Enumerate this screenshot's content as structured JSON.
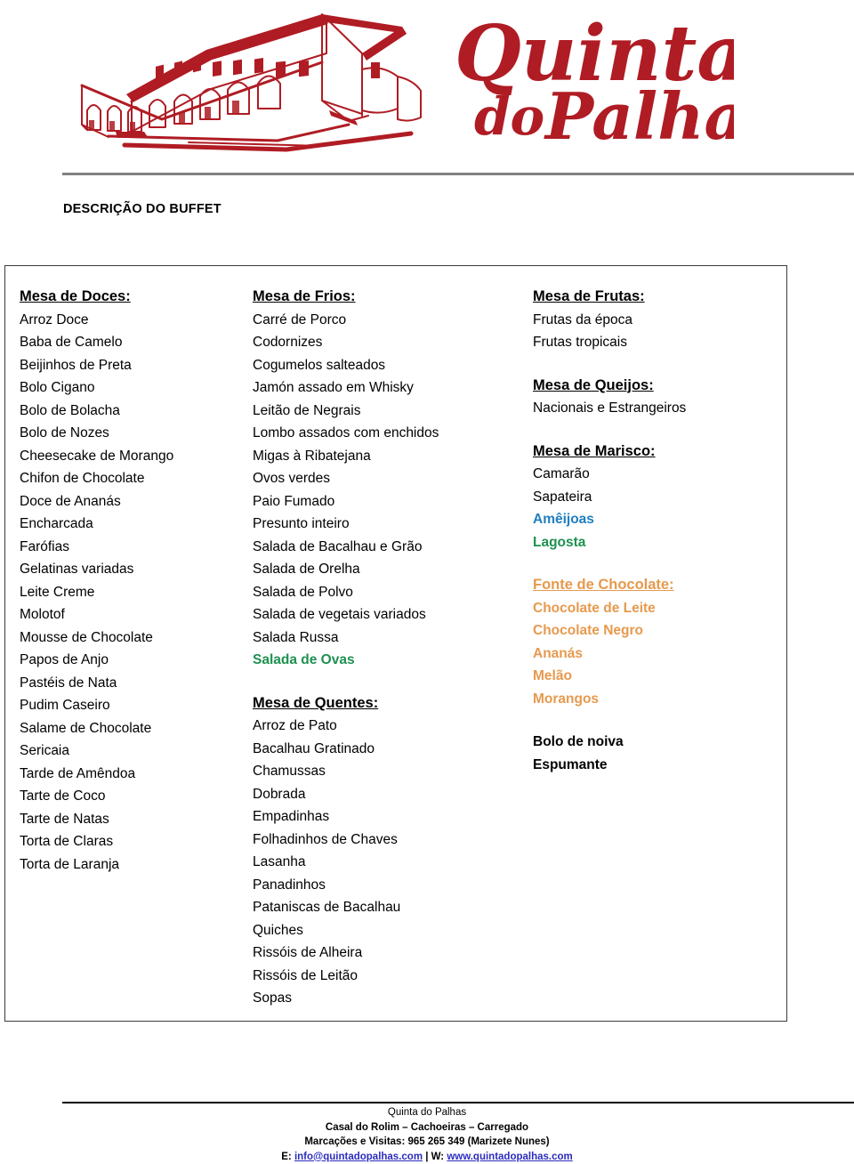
{
  "brand": {
    "name_line1": "Quinta",
    "name_line2": "do Palhas",
    "logo_color": "#B01C24",
    "drawing_name": "quinta-building-line-drawing"
  },
  "section_title": "DESCRIÇÃO DO BUFFET",
  "colors": {
    "heading_black": "#000000",
    "green": "#1E9150",
    "blue": "#1F7FC0",
    "orange": "#E69A4E",
    "rule_gray": "#808080",
    "link_blue": "#2B2BBF"
  },
  "columns": [
    {
      "id": "doces",
      "groups": [
        {
          "title": "Mesa de Doces:",
          "title_color": "#000000",
          "items": [
            {
              "text": "Arroz Doce",
              "color": "#000000",
              "bold": false
            },
            {
              "text": "Baba de Camelo",
              "color": "#000000",
              "bold": false
            },
            {
              "text": "Beijinhos de Preta",
              "color": "#000000",
              "bold": false
            },
            {
              "text": "Bolo Cigano",
              "color": "#000000",
              "bold": false
            },
            {
              "text": "Bolo de Bolacha",
              "color": "#000000",
              "bold": false
            },
            {
              "text": "Bolo de Nozes",
              "color": "#000000",
              "bold": false
            },
            {
              "text": "Cheesecake de Morango",
              "color": "#000000",
              "bold": false
            },
            {
              "text": "Chifon de Chocolate",
              "color": "#000000",
              "bold": false
            },
            {
              "text": "Doce de Ananás",
              "color": "#000000",
              "bold": false
            },
            {
              "text": "Encharcada",
              "color": "#000000",
              "bold": false
            },
            {
              "text": "Farófias",
              "color": "#000000",
              "bold": false
            },
            {
              "text": "Gelatinas variadas",
              "color": "#000000",
              "bold": false
            },
            {
              "text": "Leite Creme",
              "color": "#000000",
              "bold": false
            },
            {
              "text": "Molotof",
              "color": "#000000",
              "bold": false
            },
            {
              "text": "Mousse de Chocolate",
              "color": "#000000",
              "bold": false
            },
            {
              "text": "Papos de Anjo",
              "color": "#000000",
              "bold": false
            },
            {
              "text": "Pastéis de Nata",
              "color": "#000000",
              "bold": false
            },
            {
              "text": "Pudim Caseiro",
              "color": "#000000",
              "bold": false
            },
            {
              "text": "Salame de Chocolate",
              "color": "#000000",
              "bold": false
            },
            {
              "text": "Sericaia",
              "color": "#000000",
              "bold": false
            },
            {
              "text": "Tarde de Amêndoa",
              "color": "#000000",
              "bold": false
            },
            {
              "text": "Tarte de Coco",
              "color": "#000000",
              "bold": false
            },
            {
              "text": "Tarte de Natas",
              "color": "#000000",
              "bold": false
            },
            {
              "text": "Torta de Claras",
              "color": "#000000",
              "bold": false
            },
            {
              "text": "Torta de Laranja",
              "color": "#000000",
              "bold": false
            }
          ]
        }
      ]
    },
    {
      "id": "frios",
      "groups": [
        {
          "title": "Mesa de Frios:",
          "title_color": "#000000",
          "items": [
            {
              "text": "Carré de Porco",
              "color": "#000000",
              "bold": false
            },
            {
              "text": "Codornizes",
              "color": "#000000",
              "bold": false
            },
            {
              "text": "Cogumelos salteados",
              "color": "#000000",
              "bold": false
            },
            {
              "text": "Jamón assado em Whisky",
              "color": "#000000",
              "bold": false
            },
            {
              "text": "Leitão de Negrais",
              "color": "#000000",
              "bold": false
            },
            {
              "text": "Lombo assados com enchidos",
              "color": "#000000",
              "bold": false
            },
            {
              "text": "Migas à Ribatejana",
              "color": "#000000",
              "bold": false
            },
            {
              "text": "Ovos verdes",
              "color": "#000000",
              "bold": false
            },
            {
              "text": "Paio Fumado",
              "color": "#000000",
              "bold": false
            },
            {
              "text": "Presunto inteiro",
              "color": "#000000",
              "bold": false
            },
            {
              "text": "Salada de Bacalhau e Grão",
              "color": "#000000",
              "bold": false
            },
            {
              "text": "Salada de Orelha",
              "color": "#000000",
              "bold": false
            },
            {
              "text": "Salada de Polvo",
              "color": "#000000",
              "bold": false
            },
            {
              "text": "Salada de vegetais variados",
              "color": "#000000",
              "bold": false
            },
            {
              "text": "Salada Russa",
              "color": "#000000",
              "bold": false
            },
            {
              "text": "Salada de Ovas",
              "color": "#1E9150",
              "bold": true
            }
          ]
        },
        {
          "title": "Mesa de Quentes:",
          "title_color": "#000000",
          "items": [
            {
              "text": "Arroz de Pato",
              "color": "#000000",
              "bold": false
            },
            {
              "text": "Bacalhau Gratinado",
              "color": "#000000",
              "bold": false
            },
            {
              "text": "Chamussas",
              "color": "#000000",
              "bold": false
            },
            {
              "text": "Dobrada",
              "color": "#000000",
              "bold": false
            },
            {
              "text": "Empadinhas",
              "color": "#000000",
              "bold": false
            },
            {
              "text": "Folhadinhos de Chaves",
              "color": "#000000",
              "bold": false
            },
            {
              "text": "Lasanha",
              "color": "#000000",
              "bold": false
            },
            {
              "text": "Panadinhos",
              "color": "#000000",
              "bold": false
            },
            {
              "text": "Pataniscas de Bacalhau",
              "color": "#000000",
              "bold": false
            },
            {
              "text": "Quiches",
              "color": "#000000",
              "bold": false
            },
            {
              "text": "Rissóis de Alheira",
              "color": "#000000",
              "bold": false
            },
            {
              "text": "Rissóis de Leitão",
              "color": "#000000",
              "bold": false
            },
            {
              "text": "Sopas",
              "color": "#000000",
              "bold": false
            }
          ]
        }
      ]
    },
    {
      "id": "frutas",
      "groups": [
        {
          "title": "Mesa de Frutas:",
          "title_color": "#000000",
          "items": [
            {
              "text": "Frutas da época",
              "color": "#000000",
              "bold": false
            },
            {
              "text": "Frutas tropicais",
              "color": "#000000",
              "bold": false
            }
          ]
        },
        {
          "title": "Mesa de Queijos:",
          "title_color": "#000000",
          "items": [
            {
              "text": "Nacionais e Estrangeiros",
              "color": "#000000",
              "bold": false
            }
          ]
        },
        {
          "title": "Mesa de Marisco:",
          "title_color": "#000000",
          "items": [
            {
              "text": "Camarão",
              "color": "#000000",
              "bold": false
            },
            {
              "text": "Sapateira",
              "color": "#000000",
              "bold": false
            },
            {
              "text": "Amêijoas",
              "color": "#1F7FC0",
              "bold": true
            },
            {
              "text": "Lagosta",
              "color": "#1E9150",
              "bold": true
            }
          ]
        },
        {
          "title": "Fonte de Chocolate:",
          "title_color": "#E69A4E",
          "items": [
            {
              "text": "Chocolate de Leite",
              "color": "#E69A4E",
              "bold": true
            },
            {
              "text": "Chocolate Negro",
              "color": "#E69A4E",
              "bold": true
            },
            {
              "text": "Ananás",
              "color": "#E69A4E",
              "bold": true
            },
            {
              "text": "Melão",
              "color": "#E69A4E",
              "bold": true
            },
            {
              "text": "Morangos",
              "color": "#E69A4E",
              "bold": true
            }
          ]
        },
        {
          "title": "",
          "title_color": "#000000",
          "items": [
            {
              "text": "Bolo de noiva",
              "color": "#000000",
              "bold": true
            },
            {
              "text": "Espumante",
              "color": "#000000",
              "bold": true
            }
          ]
        }
      ]
    }
  ],
  "footer": {
    "line1": "Quinta do Palhas",
    "line2": "Casal do Rolim – Cachoeiras – Carregado",
    "line3": "Marcações e Visitas: 965 265 349 (Marizete Nunes)",
    "line4_prefix": "E: ",
    "email": "info@quintadopalhas.com",
    "line4_sep": " | W: ",
    "website": "www.quintadopalhas.com"
  }
}
